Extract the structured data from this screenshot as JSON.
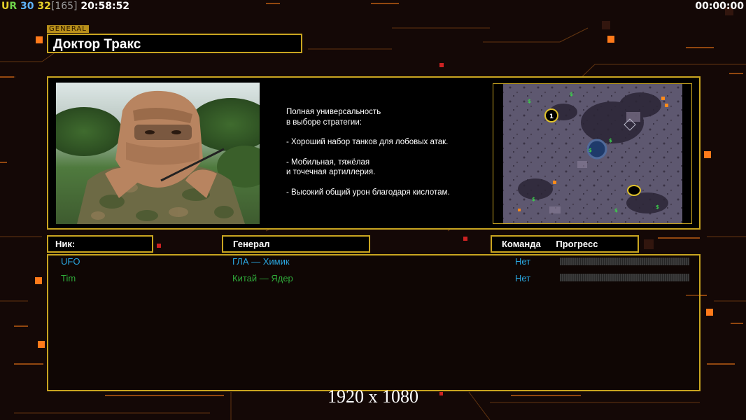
{
  "hud": {
    "ur_u": "U",
    "ur_r": "R",
    "fps1": "30",
    "fps2": "32",
    "fps3": "[165]",
    "clock": "20:58:52",
    "timer": "00:00:00"
  },
  "general": {
    "tag": "GENERAL",
    "name": "Доктор Тракс"
  },
  "description": [
    "Полная универсальность",
    "в выборе стратегии:",
    "- Хороший набор танков для лобовых атак.",
    "- Мобильная, тяжёлая",
    "и точечная артиллерия.",
    "- Высокий общий урон благодаря кислотам."
  ],
  "table": {
    "headers": {
      "nick": "Ник:",
      "general": "Генерал",
      "team": "Команда",
      "progress": "Прогресс"
    },
    "rows": [
      {
        "nick": "UFO",
        "general": "ГЛА — Химик",
        "team": "Нет",
        "progress": 0,
        "color": "#2aa7e0"
      },
      {
        "nick": "Tim",
        "general": "Китай — Ядер",
        "team": "Нет",
        "progress": 0,
        "color": "#2fa93a"
      }
    ]
  },
  "map": {
    "start_marker": "1"
  },
  "resolution": "1920 x 1080",
  "colors": {
    "frame": "#c9a520",
    "accent_orange": "#ff7a1a"
  }
}
